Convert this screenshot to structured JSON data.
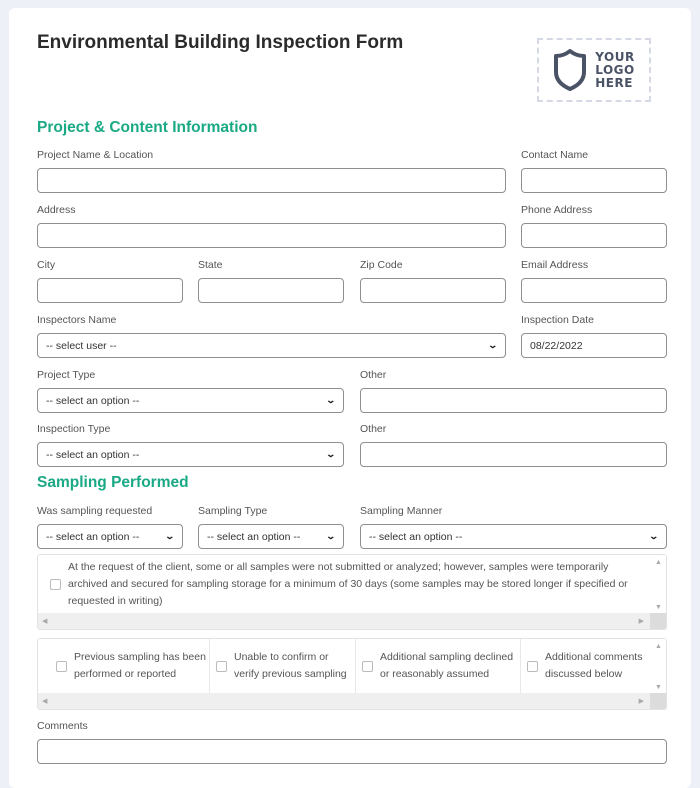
{
  "header": {
    "title": "Environmental Building Inspection Form",
    "logo_lines": [
      "YOUR",
      "LOGO",
      "HERE"
    ]
  },
  "colors": {
    "accent": "#1aa985",
    "page_bg": "#eef0f8",
    "logo": "#4a5265"
  },
  "project": {
    "section_title": "Project & Content Information",
    "project_name_label": "Project Name & Location",
    "contact_name_label": "Contact Name",
    "address_label": "Address",
    "phone_label": "Phone Address",
    "city_label": "City",
    "state_label": "State",
    "zip_label": "Zip Code",
    "email_label": "Email Address",
    "inspectors_label": "Inspectors Name",
    "inspectors_value": "-- select user --",
    "inspection_date_label": "Inspection Date",
    "inspection_date_value": "08/22/2022",
    "project_type_label": "Project Type",
    "project_type_value": "-- select an option --",
    "other1_label": "Other",
    "inspection_type_label": "Inspection Type",
    "inspection_type_value": "-- select an option --",
    "other2_label": "Other"
  },
  "sampling": {
    "section_title": "Sampling Performed",
    "requested_label": "Was sampling requested",
    "requested_value": "-- select an option --",
    "type_label": "Sampling Type",
    "type_value": "-- select an option --",
    "manner_label": "Sampling Manner",
    "manner_value": "-- select an option --",
    "archive_option": "At the request of the client, some or all samples were not submitted or analyzed; however, samples were temporarily archived and secured for sampling storage for a minimum of 30 days (some samples may be stored longer if specified or requested in writing)",
    "options": [
      "Previous sampling has been performed or reported",
      "Unable to confirm or verify previous sampling",
      "Additional sampling declined or reasonably assumed",
      "Additional comments discussed below"
    ],
    "comments_label": "Comments"
  }
}
